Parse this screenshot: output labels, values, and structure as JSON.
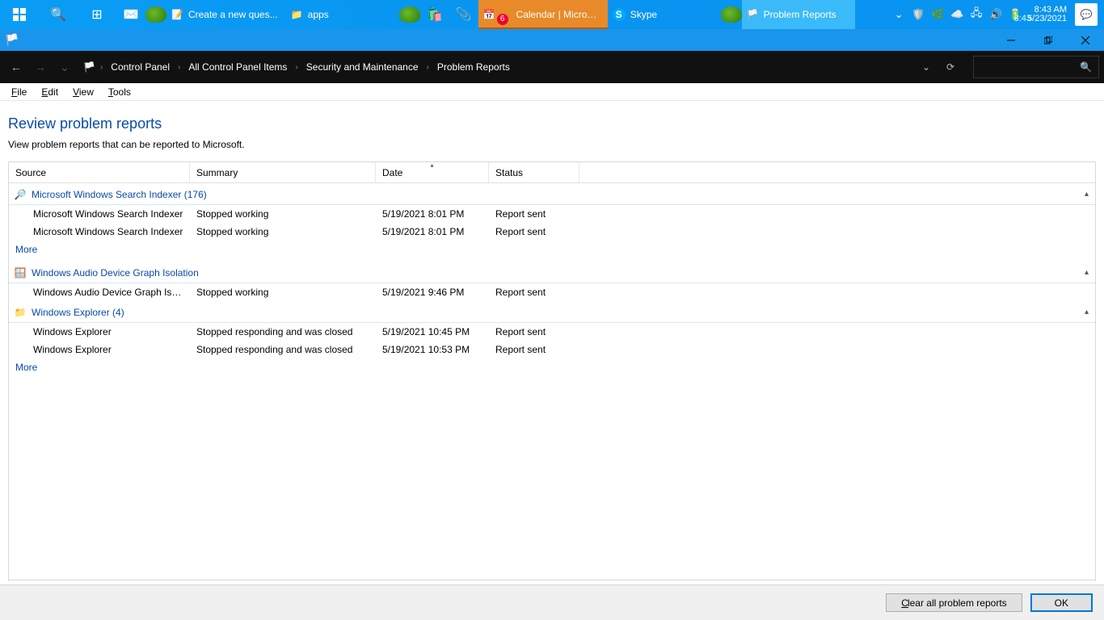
{
  "taskbar": {
    "tasks": [
      {
        "label": "Create a new ques..."
      },
      {
        "label": "apps"
      },
      {
        "label": "Calendar | Micros...",
        "badge": "6"
      },
      {
        "label": "Skype"
      },
      {
        "label": "Problem Reports"
      }
    ],
    "clock_time": "8:43 AM",
    "clock_time2": "8:43",
    "clock_date": "5/23/2021"
  },
  "breadcrumb": {
    "items": [
      "Control Panel",
      "All Control Panel Items",
      "Security and Maintenance",
      "Problem Reports"
    ]
  },
  "menu": {
    "m1": "File",
    "m2": "Edit",
    "m3": "View",
    "m4": "Tools"
  },
  "page": {
    "title": "Review problem reports",
    "subtitle": "View problem reports that can be reported to Microsoft."
  },
  "columns": {
    "source": "Source",
    "summary": "Summary",
    "date": "Date",
    "status": "Status"
  },
  "groups": [
    {
      "title": "Microsoft Windows Search Indexer (176)",
      "icon": "search-service-icon",
      "rows": [
        {
          "source": "Microsoft Windows Search Indexer",
          "summary": "Stopped working",
          "date": "5/19/2021 8:01 PM",
          "status": "Report sent"
        },
        {
          "source": "Microsoft Windows Search Indexer",
          "summary": "Stopped working",
          "date": "5/19/2021 8:01 PM",
          "status": "Report sent"
        }
      ],
      "more": "More"
    },
    {
      "title": "Windows Audio Device Graph Isolation",
      "icon": "app-icon",
      "rows": [
        {
          "source": "Windows Audio Device Graph Isol...",
          "summary": "Stopped working",
          "date": "5/19/2021 9:46 PM",
          "status": "Report sent"
        }
      ]
    },
    {
      "title": "Windows Explorer (4)",
      "icon": "folder-icon",
      "rows": [
        {
          "source": "Windows Explorer",
          "summary": "Stopped responding and was closed",
          "date": "5/19/2021 10:45 PM",
          "status": "Report sent"
        },
        {
          "source": "Windows Explorer",
          "summary": "Stopped responding and was closed",
          "date": "5/19/2021 10:53 PM",
          "status": "Report sent"
        }
      ],
      "more": "More"
    }
  ],
  "buttons": {
    "clear": "Clear all problem reports",
    "ok": "OK"
  }
}
